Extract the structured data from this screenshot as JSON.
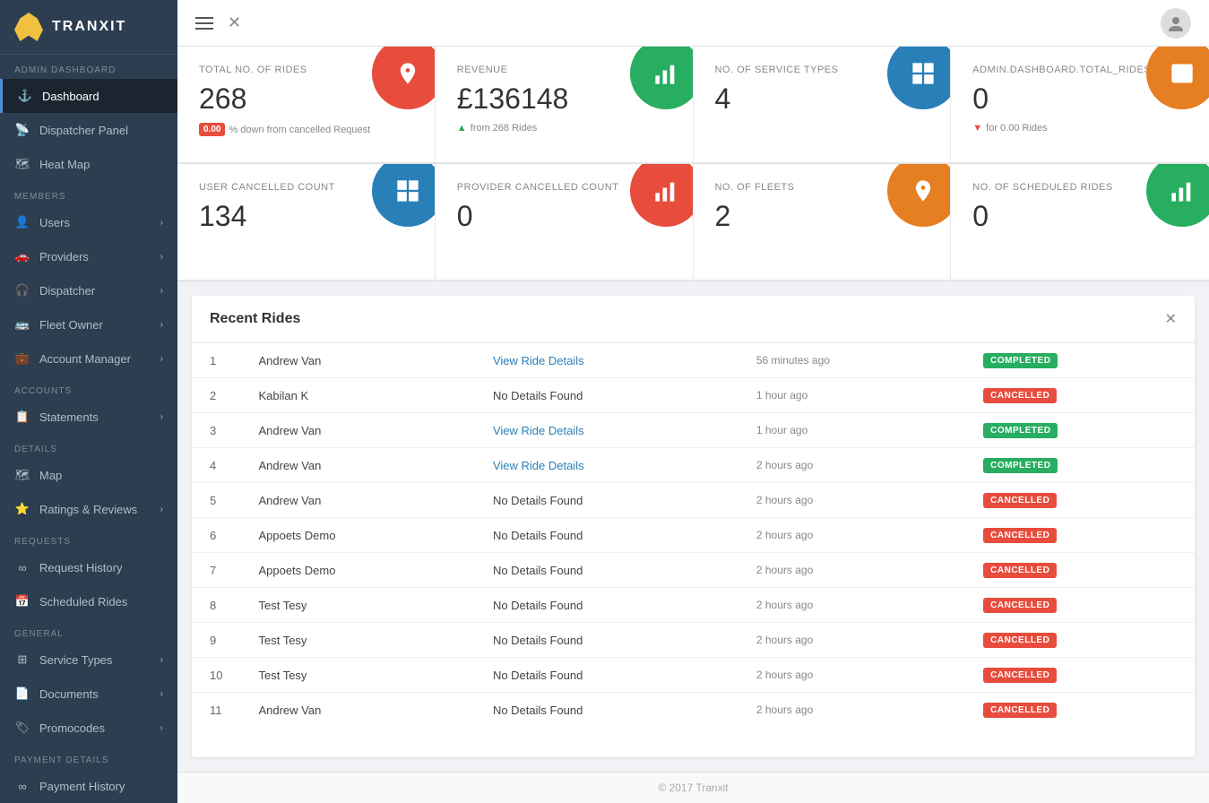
{
  "logo": {
    "text": "TRANXIT"
  },
  "topbar": {
    "close_label": "✕"
  },
  "sidebar": {
    "sections": [
      {
        "label": "ADMIN DASHBOARD",
        "items": [
          {
            "id": "dashboard",
            "label": "Dashboard",
            "active": true,
            "icon": "anchor"
          },
          {
            "id": "dispatcher-panel",
            "label": "Dispatcher Panel",
            "active": false,
            "icon": "dispatch"
          },
          {
            "id": "heat-map",
            "label": "Heat Map",
            "active": false,
            "icon": "flame"
          }
        ]
      },
      {
        "label": "MEMBERS",
        "items": [
          {
            "id": "users",
            "label": "Users",
            "active": false,
            "icon": "user",
            "has_arrow": true
          },
          {
            "id": "providers",
            "label": "Providers",
            "active": false,
            "icon": "car",
            "has_arrow": true
          },
          {
            "id": "dispatcher",
            "label": "Dispatcher",
            "active": false,
            "icon": "headset",
            "has_arrow": true
          },
          {
            "id": "fleet-owner",
            "label": "Fleet Owner",
            "active": false,
            "icon": "fleet",
            "has_arrow": true
          },
          {
            "id": "account-manager",
            "label": "Account Manager",
            "active": false,
            "icon": "briefcase",
            "has_arrow": true
          }
        ]
      },
      {
        "label": "ACCOUNTS",
        "items": [
          {
            "id": "statements",
            "label": "Statements",
            "active": false,
            "icon": "doc",
            "has_arrow": true
          }
        ]
      },
      {
        "label": "DETAILS",
        "items": [
          {
            "id": "map",
            "label": "Map",
            "active": false,
            "icon": "map"
          },
          {
            "id": "ratings-reviews",
            "label": "Ratings & Reviews",
            "active": false,
            "icon": "star",
            "has_arrow": true
          }
        ]
      },
      {
        "label": "REQUESTS",
        "items": [
          {
            "id": "request-history",
            "label": "Request History",
            "active": false,
            "icon": "infinity"
          },
          {
            "id": "scheduled-rides",
            "label": "Scheduled Rides",
            "active": false,
            "icon": "calendar"
          }
        ]
      },
      {
        "label": "GENERAL",
        "items": [
          {
            "id": "service-types",
            "label": "Service Types",
            "active": false,
            "icon": "grid",
            "has_arrow": true
          },
          {
            "id": "documents",
            "label": "Documents",
            "active": false,
            "icon": "file",
            "has_arrow": true
          },
          {
            "id": "promocodes",
            "label": "Promocodes",
            "active": false,
            "icon": "tag",
            "has_arrow": true
          }
        ]
      },
      {
        "label": "PAYMENT DETAILS",
        "items": [
          {
            "id": "payment-history",
            "label": "Payment History",
            "active": false,
            "icon": "infinity"
          }
        ]
      }
    ]
  },
  "stats_row1": [
    {
      "id": "total-rides",
      "label": "TOTAL NO. OF RIDES",
      "value": "268",
      "sub_badge": "0.00",
      "sub_text": "% down from cancelled Request",
      "icon_color": "red",
      "icon_type": "anchor"
    },
    {
      "id": "revenue",
      "label": "REVENUE",
      "value": "£136148",
      "sub_arrow": "up",
      "sub_text": "from 268 Rides",
      "icon_color": "green",
      "icon_type": "bar"
    },
    {
      "id": "service-types",
      "label": "NO. OF SERVICE TYPES",
      "value": "4",
      "icon_color": "blue",
      "icon_type": "grid"
    },
    {
      "id": "total-rides-2",
      "label": "ADMIN.DASHBOARD.TOTAL_RIDES",
      "value": "0",
      "sub_arrow": "down",
      "sub_text": "for 0.00 Rides",
      "icon_color": "orange",
      "icon_type": "box"
    }
  ],
  "stats_row2": [
    {
      "id": "user-cancelled",
      "label": "USER CANCELLED COUNT",
      "value": "134",
      "icon_color": "blue",
      "icon_type": "grid"
    },
    {
      "id": "provider-cancelled",
      "label": "PROVIDER CANCELLED COUNT",
      "value": "0",
      "icon_color": "red",
      "icon_type": "bar"
    },
    {
      "id": "no-fleets",
      "label": "NO. OF FLEETS",
      "value": "2",
      "icon_color": "orange",
      "icon_type": "anchor"
    },
    {
      "id": "scheduled-rides",
      "label": "NO. OF SCHEDULED RIDES",
      "value": "0",
      "icon_color": "green",
      "icon_type": "bar"
    }
  ],
  "recent_rides": {
    "title": "Recent Rides",
    "close_label": "✕",
    "rides": [
      {
        "num": "1",
        "name": "Andrew Van",
        "details": "View Ride Details",
        "has_link": true,
        "time": "56 minutes ago",
        "status": "COMPLETED"
      },
      {
        "num": "2",
        "name": "Kabilan K",
        "details": "No Details Found",
        "has_link": false,
        "time": "1 hour ago",
        "status": "CANCELLED"
      },
      {
        "num": "3",
        "name": "Andrew Van",
        "details": "View Ride Details",
        "has_link": true,
        "time": "1 hour ago",
        "status": "COMPLETED"
      },
      {
        "num": "4",
        "name": "Andrew Van",
        "details": "View Ride Details",
        "has_link": true,
        "time": "2 hours ago",
        "status": "COMPLETED"
      },
      {
        "num": "5",
        "name": "Andrew Van",
        "details": "No Details Found",
        "has_link": false,
        "time": "2 hours ago",
        "status": "CANCELLED"
      },
      {
        "num": "6",
        "name": "Appoets Demo",
        "details": "No Details Found",
        "has_link": false,
        "time": "2 hours ago",
        "status": "CANCELLED"
      },
      {
        "num": "7",
        "name": "Appoets Demo",
        "details": "No Details Found",
        "has_link": false,
        "time": "2 hours ago",
        "status": "CANCELLED"
      },
      {
        "num": "8",
        "name": "Test Tesy",
        "details": "No Details Found",
        "has_link": false,
        "time": "2 hours ago",
        "status": "CANCELLED"
      },
      {
        "num": "9",
        "name": "Test Tesy",
        "details": "No Details Found",
        "has_link": false,
        "time": "2 hours ago",
        "status": "CANCELLED"
      },
      {
        "num": "10",
        "name": "Test Tesy",
        "details": "No Details Found",
        "has_link": false,
        "time": "2 hours ago",
        "status": "CANCELLED"
      },
      {
        "num": "11",
        "name": "Andrew Van",
        "details": "No Details Found",
        "has_link": false,
        "time": "2 hours ago",
        "status": "CANCELLED"
      }
    ]
  },
  "footer": {
    "text": "© 2017 Tranxit"
  }
}
